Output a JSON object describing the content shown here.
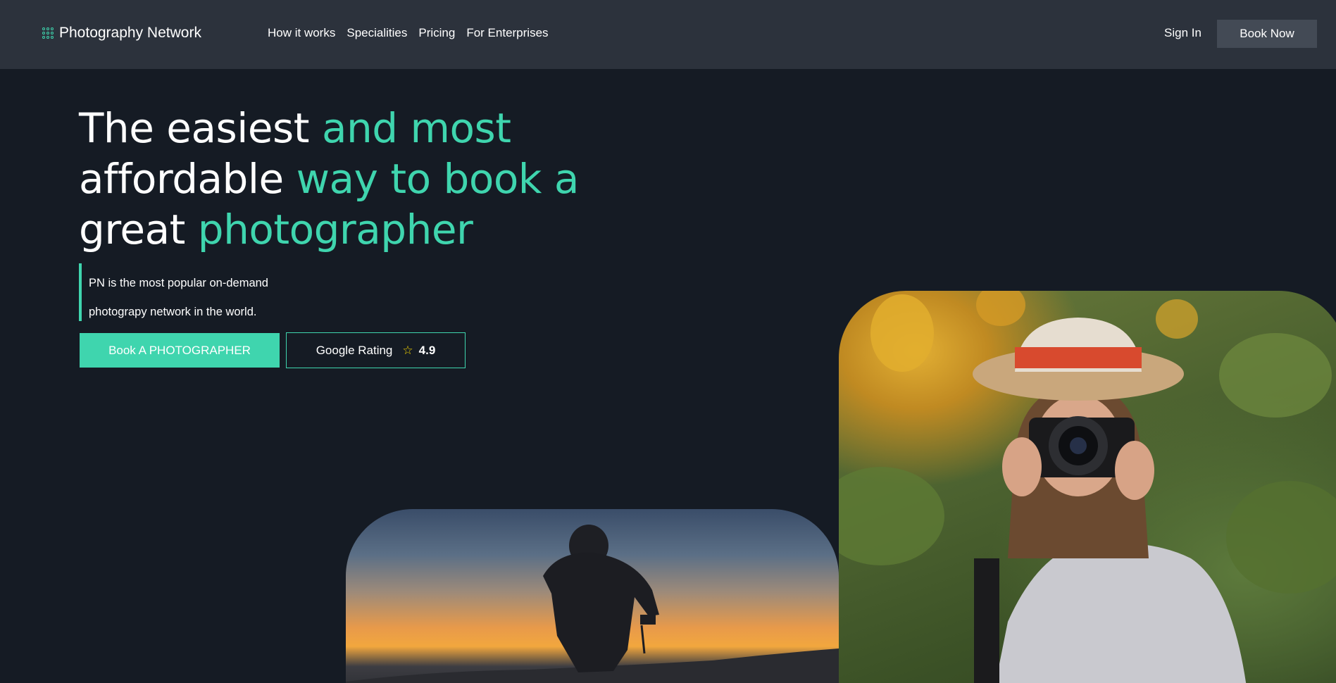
{
  "brand": {
    "name": "Photography Network",
    "icon": "grid-dots-icon",
    "accent_color": "#3fd5ae"
  },
  "nav": {
    "links": [
      "How it works",
      "Specialities",
      "Pricing",
      "For Enterprises"
    ],
    "sign_in": "Sign In",
    "book_now": "Book Now"
  },
  "hero": {
    "title": {
      "line1_plain": "The easiest ",
      "line1_accent": "and most",
      "line2_plain": "affordable ",
      "line2_accent": "way to book a",
      "line3_plain": "great ",
      "line3_accent": "photographer"
    },
    "subtitle_line1": "PN is the most popular on-demand",
    "subtitle_line2": "photograpy network in the world.",
    "cta_primary": "Book A PHOTOGRAPHER",
    "rating_label": "Google Rating",
    "rating_icon": "star-icon",
    "rating_value": "4.9"
  },
  "colors": {
    "background": "#151b24",
    "navbar": "#2c323c",
    "accent": "#3fd5ae",
    "star": "#f2d200"
  }
}
